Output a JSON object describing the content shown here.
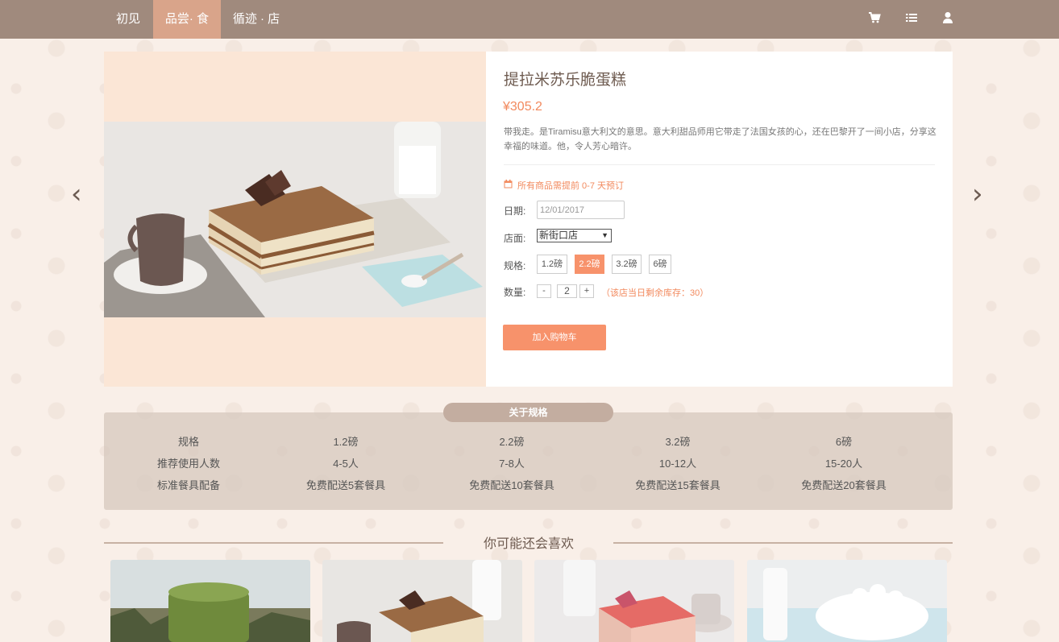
{
  "nav": {
    "items": [
      {
        "label": "初见",
        "active": false
      },
      {
        "label": "品尝· 食",
        "active": true
      },
      {
        "label": "循迹 · 店",
        "active": false
      }
    ],
    "icons": [
      "cart-icon",
      "list-icon",
      "user-icon"
    ]
  },
  "product": {
    "title": "提拉米苏乐脆蛋糕",
    "price": "¥305.2",
    "description": "带我走。是Tiramisu意大利文的意思。意大利甜品师用它带走了法国女孩的心，还在巴黎开了一间小店，分享这幸福的味道。他，令人芳心暗许。",
    "notice": "所有商品需提前 0-7 天预订",
    "date_label": "日期:",
    "date_value": "12/01/2017",
    "store_label": "店面:",
    "store_value": "新街口店",
    "spec_label": "规格:",
    "specs": [
      "1.2磅",
      "2.2磅",
      "3.2磅",
      "6磅"
    ],
    "selected_spec": "2.2磅",
    "qty_label": "数量:",
    "qty_minus": "-",
    "qty_value": "2",
    "qty_plus": "+",
    "stock_note": "（该店当日剩余库存：30）",
    "cart_button": "加入购物车"
  },
  "spec_table": {
    "tag": "关于规格",
    "rows": [
      [
        "规格",
        "1.2磅",
        "2.2磅",
        "3.2磅",
        "6磅"
      ],
      [
        "推荐使用人数",
        "4-5人",
        "7-8人",
        "10-12人",
        "15-20人"
      ],
      [
        "标准餐具配备",
        "免费配送5套餐具",
        "免费配送10套餐具",
        "免费配送15套餐具",
        "免费配送20套餐具"
      ]
    ]
  },
  "recommend": {
    "title": "你可能还会喜欢"
  },
  "colors": {
    "nav_bg": "#a08a7d",
    "nav_active": "#d9a48a",
    "accent": "#f7926b",
    "page_bg": "#f9efe8"
  }
}
